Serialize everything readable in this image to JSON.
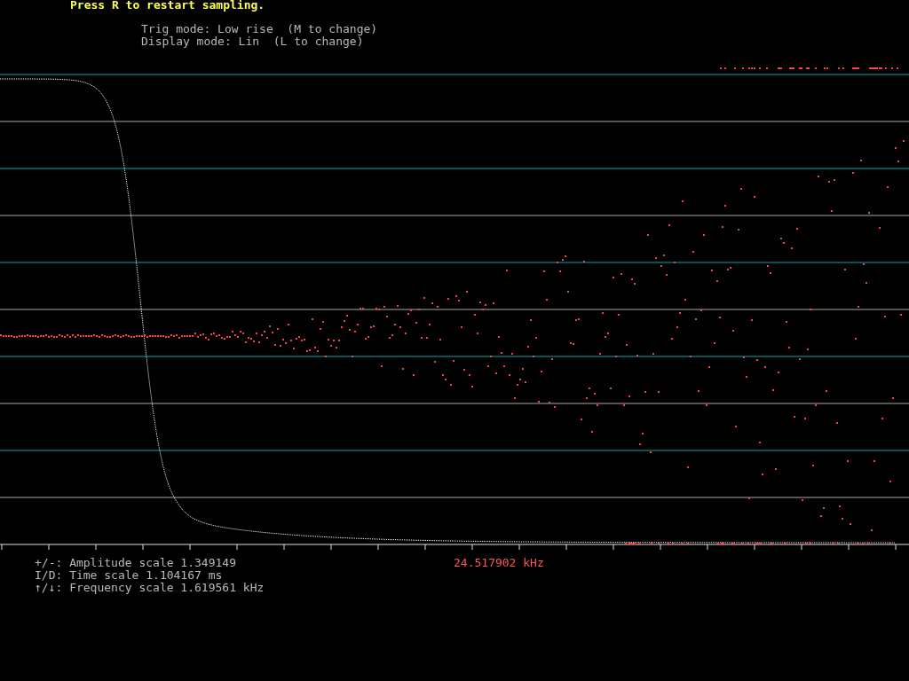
{
  "prompt": "Press R to restart sampling.",
  "status_lines": [
    "Trig mode: Low rise  (M to change)",
    "Display mode: Lin  (L to change)"
  ],
  "scale_lines": [
    "+/-: Amplitude scale 1.349149",
    "I/D: Time scale 1.104167 ms",
    "↑/↓: Frequency scale 1.619561 kHz"
  ],
  "frequency_readout": "24.517902 kHz"
}
